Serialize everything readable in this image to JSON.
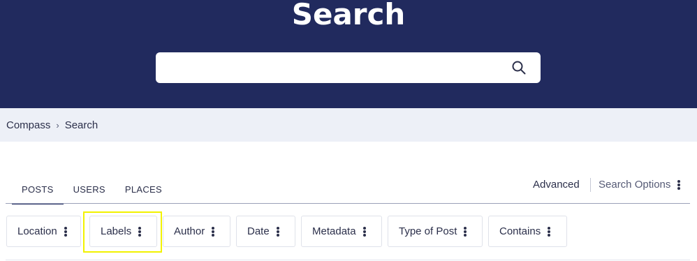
{
  "hero": {
    "title": "Search",
    "search_placeholder": "",
    "search_icon": "search-icon"
  },
  "breadcrumb": {
    "items": [
      "Compass",
      "Search"
    ],
    "separator": "›"
  },
  "tabs": [
    {
      "label": "POSTS",
      "active": true
    },
    {
      "label": "USERS",
      "active": false
    },
    {
      "label": "PLACES",
      "active": false
    }
  ],
  "options": {
    "advanced": "Advanced",
    "search_options": "Search Options"
  },
  "filters": [
    {
      "label": "Location"
    },
    {
      "label": "Labels",
      "highlighted": true
    },
    {
      "label": "Author"
    },
    {
      "label": "Date"
    },
    {
      "label": "Metadata"
    },
    {
      "label": "Type of Post"
    },
    {
      "label": "Contains"
    }
  ],
  "colors": {
    "hero_bg": "#212a5e",
    "breadcrumb_bg": "#edf0f7",
    "highlight": "#f2f200",
    "text": "#2b2f4a"
  }
}
